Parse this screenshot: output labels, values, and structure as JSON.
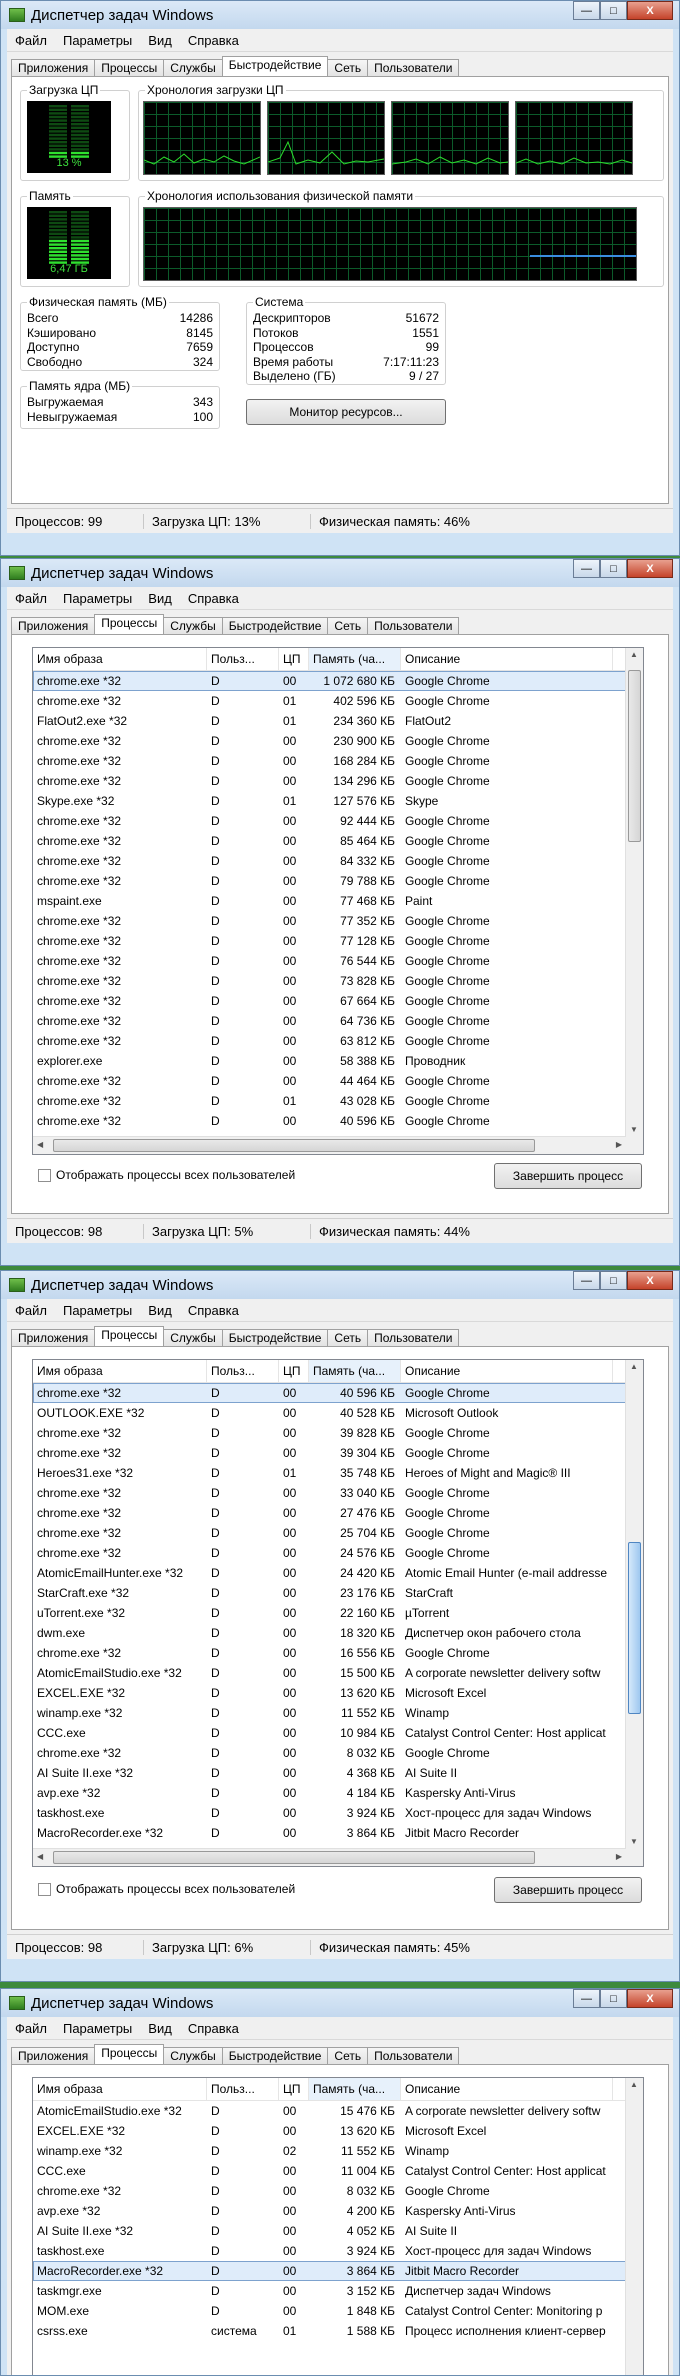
{
  "app": {
    "title": "Диспетчер задач Windows",
    "menu": [
      "Файл",
      "Параметры",
      "Вид",
      "Справка"
    ],
    "tabs": [
      "Приложения",
      "Процессы",
      "Службы",
      "Быстродействие",
      "Сеть",
      "Пользователи"
    ],
    "win_buttons": {
      "min": "—",
      "max": "□",
      "close": "X"
    }
  },
  "performance": {
    "cpu_usage_label": "Загрузка ЦП",
    "cpu_percent": "13 %",
    "cpu_history_label": "Хронология загрузки ЦП",
    "memory_label": "Память",
    "memory_value": "6,47 ГБ",
    "memory_history_label": "Хронология использования физической памяти",
    "physical_memory": {
      "title": "Физическая память (МБ)",
      "rows": [
        {
          "k": "Всего",
          "v": "14286"
        },
        {
          "k": "Кэшировано",
          "v": "8145"
        },
        {
          "k": "Доступно",
          "v": "7659"
        },
        {
          "k": "Свободно",
          "v": "324"
        }
      ]
    },
    "kernel_memory": {
      "title": "Память ядра (МБ)",
      "rows": [
        {
          "k": "Выгружаемая",
          "v": "343"
        },
        {
          "k": "Невыгружаемая",
          "v": "100"
        }
      ]
    },
    "system": {
      "title": "Система",
      "rows": [
        {
          "k": "Дескрипторов",
          "v": "51672"
        },
        {
          "k": "Потоков",
          "v": "1551"
        },
        {
          "k": "Процессов",
          "v": "99"
        },
        {
          "k": "Время работы",
          "v": "7:17:11:23"
        },
        {
          "k": "Выделено (ГБ)",
          "v": "9 / 27"
        }
      ]
    },
    "resource_monitor_button": "Монитор ресурсов...",
    "status": [
      "Процессов: 99",
      "Загрузка ЦП: 13%",
      "Физическая память: 46%"
    ]
  },
  "columns": [
    "Имя образа",
    "Польз...",
    "ЦП",
    "Память (ча...",
    "Описание"
  ],
  "show_all_label": "Отображать процессы всех пользователей",
  "end_process_button": "Завершить процесс",
  "proc1": {
    "rows": [
      [
        "chrome.exe *32",
        "D",
        "00",
        "1 072 680 КБ",
        "Google Chrome"
      ],
      [
        "chrome.exe *32",
        "D",
        "01",
        "402 596 КБ",
        "Google Chrome"
      ],
      [
        "FlatOut2.exe *32",
        "D",
        "01",
        "234 360 КБ",
        "FlatOut2"
      ],
      [
        "chrome.exe *32",
        "D",
        "00",
        "230 900 КБ",
        "Google Chrome"
      ],
      [
        "chrome.exe *32",
        "D",
        "00",
        "168 284 КБ",
        "Google Chrome"
      ],
      [
        "chrome.exe *32",
        "D",
        "00",
        "134 296 КБ",
        "Google Chrome"
      ],
      [
        "Skype.exe *32",
        "D",
        "01",
        "127 576 КБ",
        "Skype"
      ],
      [
        "chrome.exe *32",
        "D",
        "00",
        "92 444 КБ",
        "Google Chrome"
      ],
      [
        "chrome.exe *32",
        "D",
        "00",
        "85 464 КБ",
        "Google Chrome"
      ],
      [
        "chrome.exe *32",
        "D",
        "00",
        "84 332 КБ",
        "Google Chrome"
      ],
      [
        "chrome.exe *32",
        "D",
        "00",
        "79 788 КБ",
        "Google Chrome"
      ],
      [
        "mspaint.exe",
        "D",
        "00",
        "77 468 КБ",
        "Paint"
      ],
      [
        "chrome.exe *32",
        "D",
        "00",
        "77 352 КБ",
        "Google Chrome"
      ],
      [
        "chrome.exe *32",
        "D",
        "00",
        "77 128 КБ",
        "Google Chrome"
      ],
      [
        "chrome.exe *32",
        "D",
        "00",
        "76 544 КБ",
        "Google Chrome"
      ],
      [
        "chrome.exe *32",
        "D",
        "00",
        "73 828 КБ",
        "Google Chrome"
      ],
      [
        "chrome.exe *32",
        "D",
        "00",
        "67 664 КБ",
        "Google Chrome"
      ],
      [
        "chrome.exe *32",
        "D",
        "00",
        "64 736 КБ",
        "Google Chrome"
      ],
      [
        "chrome.exe *32",
        "D",
        "00",
        "63 812 КБ",
        "Google Chrome"
      ],
      [
        "explorer.exe",
        "D",
        "00",
        "58 388 КБ",
        "Проводник"
      ],
      [
        "chrome.exe *32",
        "D",
        "00",
        "44 464 КБ",
        "Google Chrome"
      ],
      [
        "chrome.exe *32",
        "D",
        "01",
        "43 028 КБ",
        "Google Chrome"
      ],
      [
        "chrome.exe *32",
        "D",
        "00",
        "40 596 КБ",
        "Google Chrome"
      ]
    ],
    "status": [
      "Процессов: 98",
      "Загрузка ЦП: 5%",
      "Физическая память: 44%"
    ]
  },
  "proc2": {
    "rows": [
      [
        "chrome.exe *32",
        "D",
        "00",
        "40 596 КБ",
        "Google Chrome"
      ],
      [
        "OUTLOOK.EXE *32",
        "D",
        "00",
        "40 528 КБ",
        "Microsoft Outlook"
      ],
      [
        "chrome.exe *32",
        "D",
        "00",
        "39 828 КБ",
        "Google Chrome"
      ],
      [
        "chrome.exe *32",
        "D",
        "00",
        "39 304 КБ",
        "Google Chrome"
      ],
      [
        "Heroes31.exe *32",
        "D",
        "01",
        "35 748 КБ",
        "Heroes of Might and Magic® III"
      ],
      [
        "chrome.exe *32",
        "D",
        "00",
        "33 040 КБ",
        "Google Chrome"
      ],
      [
        "chrome.exe *32",
        "D",
        "00",
        "27 476 КБ",
        "Google Chrome"
      ],
      [
        "chrome.exe *32",
        "D",
        "00",
        "25 704 КБ",
        "Google Chrome"
      ],
      [
        "chrome.exe *32",
        "D",
        "00",
        "24 576 КБ",
        "Google Chrome"
      ],
      [
        "AtomicEmailHunter.exe *32",
        "D",
        "00",
        "24 420 КБ",
        "Atomic Email Hunter (e-mail addresse"
      ],
      [
        "StarCraft.exe *32",
        "D",
        "00",
        "23 176 КБ",
        "StarCraft"
      ],
      [
        "uTorrent.exe *32",
        "D",
        "00",
        "22 160 КБ",
        "µTorrent"
      ],
      [
        "dwm.exe",
        "D",
        "00",
        "18 320 КБ",
        "Диспетчер окон рабочего стола"
      ],
      [
        "chrome.exe *32",
        "D",
        "00",
        "16 556 КБ",
        "Google Chrome"
      ],
      [
        "AtomicEmailStudio.exe *32",
        "D",
        "00",
        "15 500 КБ",
        "A corporate newsletter delivery softw"
      ],
      [
        "EXCEL.EXE *32",
        "D",
        "00",
        "13 620 КБ",
        "Microsoft Excel"
      ],
      [
        "winamp.exe *32",
        "D",
        "00",
        "11 552 КБ",
        "Winamp"
      ],
      [
        "CCC.exe",
        "D",
        "00",
        "10 984 КБ",
        "Catalyst Control Center: Host applicat"
      ],
      [
        "chrome.exe *32",
        "D",
        "00",
        "8 032 КБ",
        "Google Chrome"
      ],
      [
        "AI Suite II.exe *32",
        "D",
        "00",
        "4 368 КБ",
        "AI Suite II"
      ],
      [
        "avp.exe *32",
        "D",
        "00",
        "4 184 КБ",
        "Kaspersky Anti-Virus"
      ],
      [
        "taskhost.exe",
        "D",
        "00",
        "3 924 КБ",
        "Хост-процесс для задач Windows"
      ],
      [
        "MacroRecorder.exe *32",
        "D",
        "00",
        "3 864 КБ",
        "Jitbit Macro Recorder"
      ]
    ],
    "status": [
      "Процессов: 98",
      "Загрузка ЦП: 6%",
      "Физическая память: 45%"
    ]
  },
  "proc3": {
    "rows": [
      [
        "AtomicEmailStudio.exe *32",
        "D",
        "00",
        "15 476 КБ",
        "A corporate newsletter delivery softw"
      ],
      [
        "EXCEL.EXE *32",
        "D",
        "00",
        "13 620 КБ",
        "Microsoft Excel"
      ],
      [
        "winamp.exe *32",
        "D",
        "02",
        "11 552 КБ",
        "Winamp"
      ],
      [
        "CCC.exe",
        "D",
        "00",
        "11 004 КБ",
        "Catalyst Control Center: Host applicat"
      ],
      [
        "chrome.exe *32",
        "D",
        "00",
        "8 032 КБ",
        "Google Chrome"
      ],
      [
        "avp.exe *32",
        "D",
        "00",
        "4 200 КБ",
        "Kaspersky Anti-Virus"
      ],
      [
        "AI Suite II.exe *32",
        "D",
        "00",
        "4 052 КБ",
        "AI Suite II"
      ],
      [
        "taskhost.exe",
        "D",
        "00",
        "3 924 КБ",
        "Хост-процесс для задач Windows"
      ],
      [
        "MacroRecorder.exe *32",
        "D",
        "00",
        "3 864 КБ",
        "Jitbit Macro Recorder"
      ],
      [
        "taskmgr.exe",
        "D",
        "00",
        "3 152 КБ",
        "Диспетчер задач Windows"
      ],
      [
        "MOM.exe",
        "D",
        "00",
        "1 848 КБ",
        "Catalyst Control Center: Monitoring p"
      ],
      [
        "csrss.exe",
        "система",
        "01",
        "1 588 КБ",
        "Процесс исполнения клиент-сервер"
      ]
    ]
  }
}
